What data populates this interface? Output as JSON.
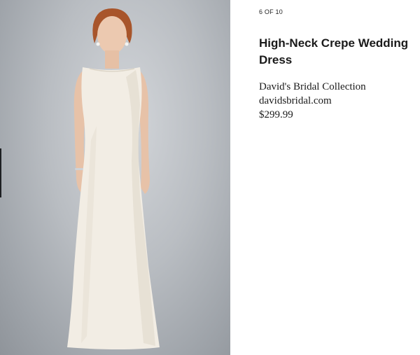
{
  "gallery": {
    "counter": "6 OF 10"
  },
  "product": {
    "title": "High-Neck Crepe Wedding Dress",
    "collection": "David's Bridal Collection",
    "source": "davidsbridal.com",
    "price": "$299.99"
  },
  "image": {
    "subject": "model wearing white high-neck crepe wedding dress",
    "background_color": "#aeb2b7",
    "dress_color": "#f2ede4"
  }
}
